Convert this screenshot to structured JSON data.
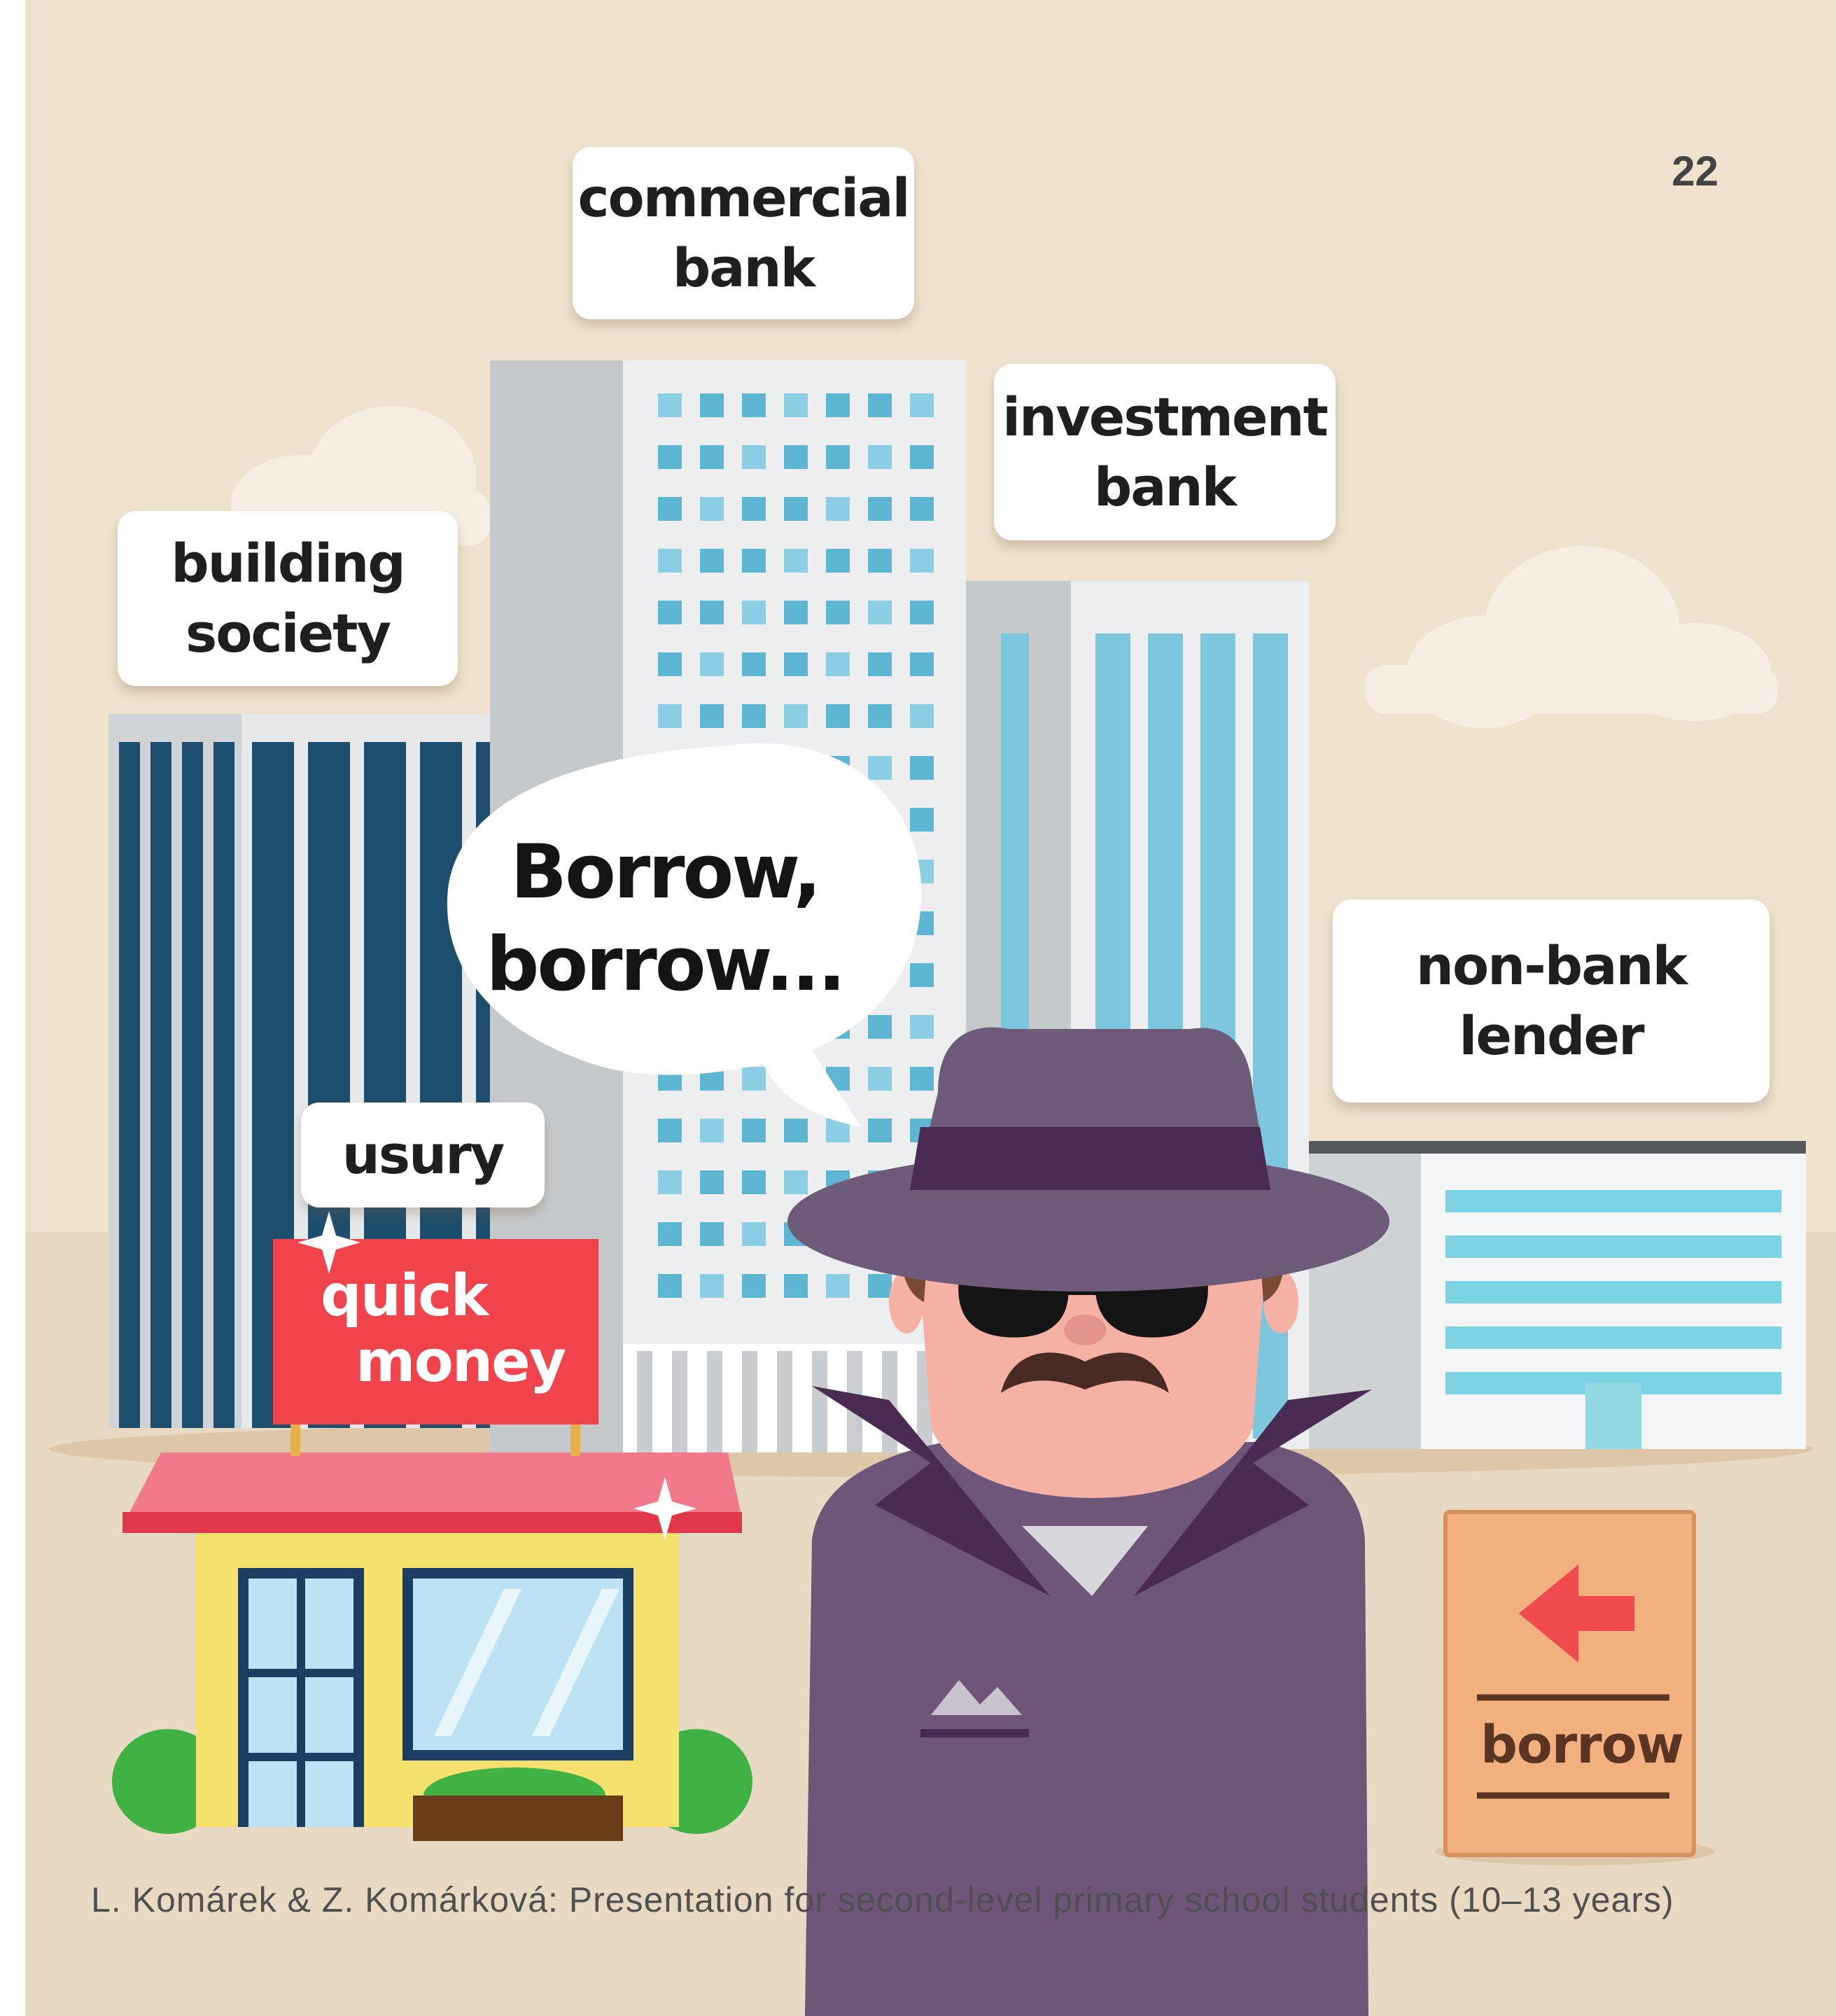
{
  "slide": {
    "page_number": "22",
    "footer": "L. Komárek & Z. Komárková: Presentation for second-level primary school students (10–13 years)"
  },
  "labels": {
    "commercial_bank": [
      "commercial",
      "bank"
    ],
    "investment_bank": [
      "investment",
      "bank"
    ],
    "building_society": [
      "building",
      "society"
    ],
    "non_bank_lender": [
      "non-bank",
      "lender"
    ],
    "usury": "usury"
  },
  "speech_bubble": [
    "Borrow,",
    "borrow..."
  ],
  "shop_sign": [
    "quick",
    "money"
  ],
  "arrow_sign": "borrow",
  "colors": {
    "background": "#efe3cf",
    "ground": "#e6d5bc",
    "sign_red": "#f0434c",
    "coat": "#6d5678",
    "hat": "#6e5a79",
    "hat_band": "#4a2c52",
    "skin": "#f6b1a5",
    "window_blue": "#74c6dc",
    "dark_blue": "#1e4e6e",
    "awning": "#f07a8a",
    "shop_yellow": "#f6e06e"
  }
}
